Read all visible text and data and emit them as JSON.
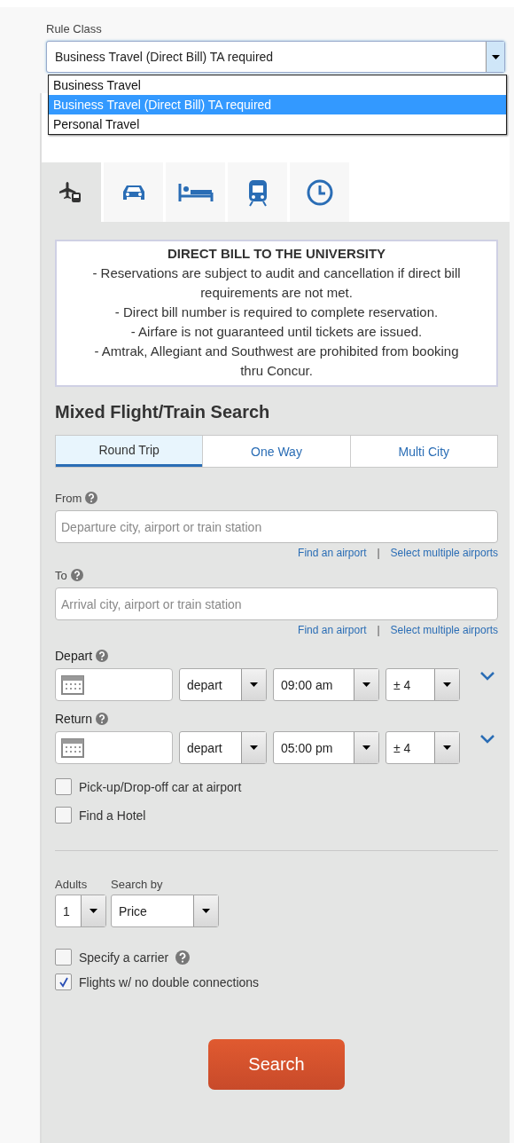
{
  "rule_class": {
    "label": "Rule Class",
    "value": "Business Travel (Direct Bill) TA required",
    "expanded": true,
    "options": [
      {
        "label": "Business Travel",
        "selected": false
      },
      {
        "label": "Business Travel (Direct Bill) TA required",
        "selected": true
      },
      {
        "label": "Personal Travel",
        "selected": false
      }
    ]
  },
  "mode_tabs": [
    {
      "kind": "flight_train",
      "selected": true
    },
    {
      "kind": "car",
      "selected": false
    },
    {
      "kind": "hotel",
      "selected": false
    },
    {
      "kind": "train",
      "selected": false
    },
    {
      "kind": "clock",
      "selected": false
    }
  ],
  "notice": {
    "title": "DIRECT BILL TO THE UNIVERSITY",
    "lines": [
      "- Reservations are subject to audit and cancellation if direct bill requirements are not met.",
      "- Direct bill number is required to complete reservation.",
      "- Airfare is not guaranteed until tickets are issued.",
      "- Amtrak, Allegiant and Southwest are prohibited from booking thru Concur."
    ]
  },
  "heading": "Mixed Flight/Train Search",
  "trip_types": [
    {
      "label": "Round Trip",
      "selected": true
    },
    {
      "label": "One Way",
      "selected": false
    },
    {
      "label": "Multi City",
      "selected": false
    }
  ],
  "locations": [
    {
      "label": "From",
      "placeholder": "Departure city, airport or train station",
      "links": [
        "Find an airport",
        "Select multiple airports"
      ],
      "separator": "|"
    },
    {
      "label": "To",
      "placeholder": "Arrival city, airport or train station",
      "links": [
        "Find an airport",
        "Select multiple airports"
      ],
      "separator": "|"
    }
  ],
  "dates": [
    {
      "label": "Depart",
      "mode": "depart",
      "time": "09:00 am",
      "window": "± 4"
    },
    {
      "label": "Return",
      "mode": "depart",
      "time": "05:00 pm",
      "window": "± 4"
    }
  ],
  "extras": [
    {
      "label": "Pick-up/Drop-off car at airport",
      "checked": false
    },
    {
      "label": "Find a Hotel",
      "checked": false
    }
  ],
  "adults": {
    "label": "Adults",
    "value": "1"
  },
  "search_by": {
    "label": "Search by",
    "value": "Price"
  },
  "filters": [
    {
      "label": "Specify a carrier",
      "checked": false,
      "help": true
    },
    {
      "label": "Flights w/ no double connections",
      "checked": true,
      "help": false
    }
  ],
  "search_button": "Search"
}
